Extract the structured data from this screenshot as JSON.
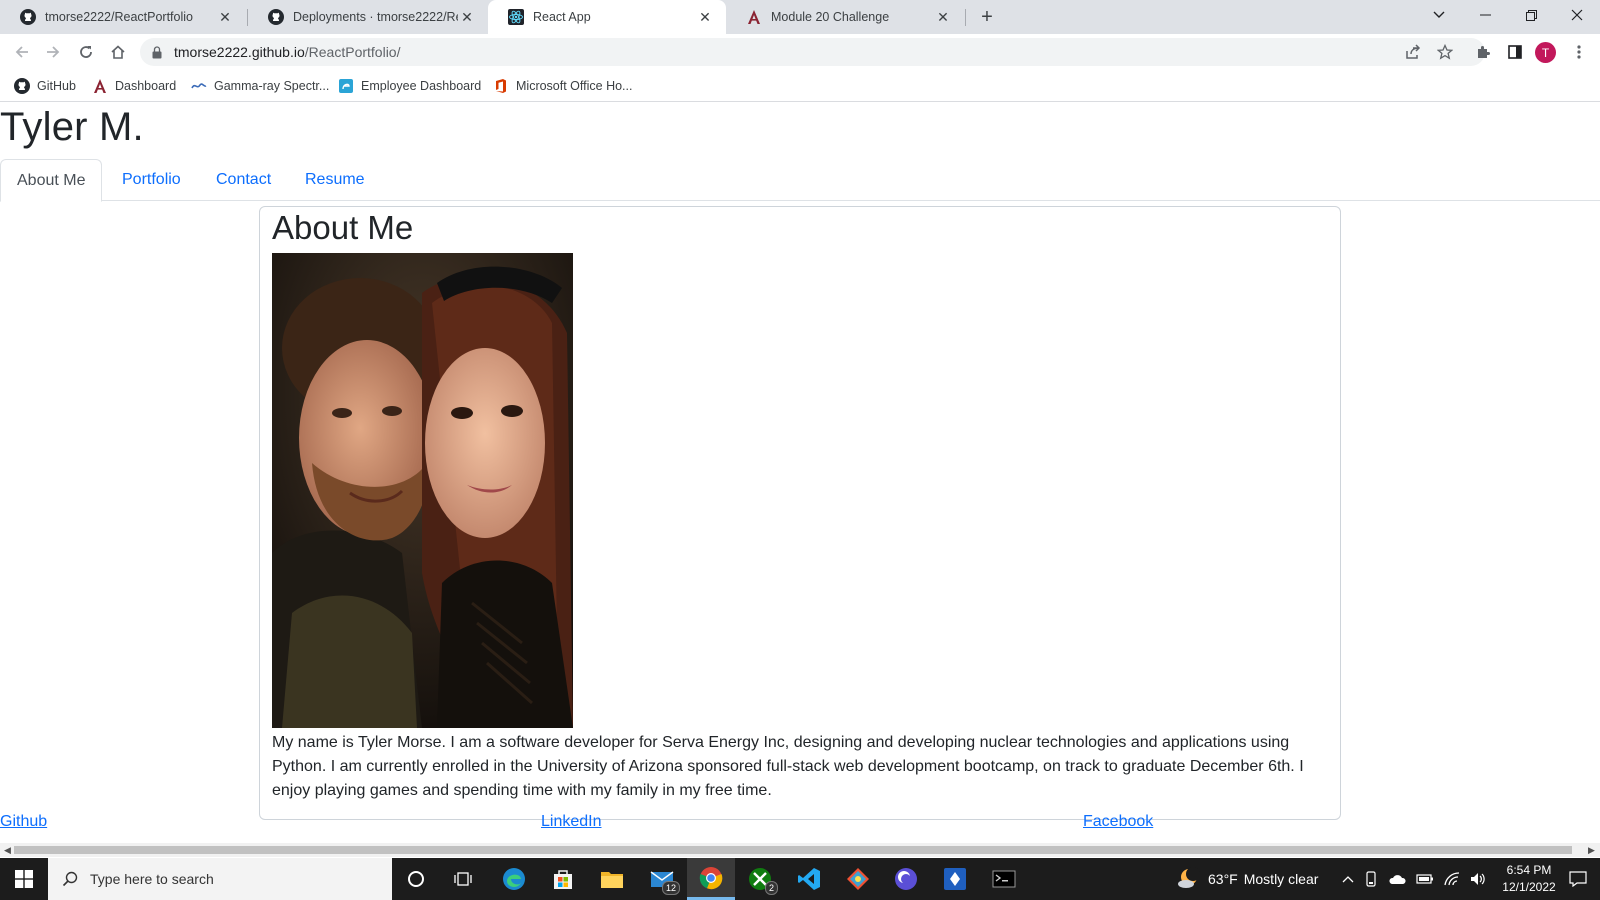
{
  "browser": {
    "tabs": [
      {
        "title": "tmorse2222/ReactPortfolio",
        "favicon": "github-icon",
        "active": false
      },
      {
        "title": "Deployments · tmorse2222/ReactPortfolio",
        "favicon": "github-icon",
        "active": false
      },
      {
        "title": "React App",
        "favicon": "react-icon",
        "active": true
      },
      {
        "title": "Module 20 Challenge",
        "favicon": "canvas-icon",
        "active": false
      }
    ],
    "url_host": "tmorse2222.github.io",
    "url_path": "/ReactPortfolio/",
    "profile_initial": "T",
    "bookmarks": [
      {
        "label": "GitHub",
        "icon": "github-icon"
      },
      {
        "label": "Dashboard",
        "icon": "canvas-icon"
      },
      {
        "label": "Gamma-ray Spectr...",
        "icon": "spectrum-icon"
      },
      {
        "label": "Employee Dashboard",
        "icon": "edge-page-icon"
      },
      {
        "label": "Microsoft Office Ho...",
        "icon": "office-icon"
      }
    ]
  },
  "site": {
    "title": "Tyler M.",
    "nav": [
      {
        "label": "About Me",
        "active": true
      },
      {
        "label": "Portfolio",
        "active": false
      },
      {
        "label": "Contact",
        "active": false
      },
      {
        "label": "Resume",
        "active": false
      }
    ],
    "section_heading": "About Me",
    "bio": "My name is Tyler Morse. I am a software developer for Serva Energy Inc, designing and developing nuclear technologies and applications using Python. I am currently enrolled in the University of Arizona sponsored full-stack web development bootcamp, on track to graduate December 6th. I enjoy playing games and spending time with my family in my free time.",
    "footer_links": [
      "Github",
      "LinkedIn",
      "Facebook"
    ]
  },
  "taskbar": {
    "search_placeholder": "Type here to search",
    "mail_badge": "12",
    "xbox_badge": "2",
    "weather_temp": "63°F",
    "weather_text": "Mostly clear",
    "time": "6:54 PM",
    "date": "12/1/2022"
  },
  "colors": {
    "link": "#0d6efd",
    "heading": "#212529",
    "tab_strip": "#dee1e6",
    "taskbar": "#1c1c1c"
  }
}
